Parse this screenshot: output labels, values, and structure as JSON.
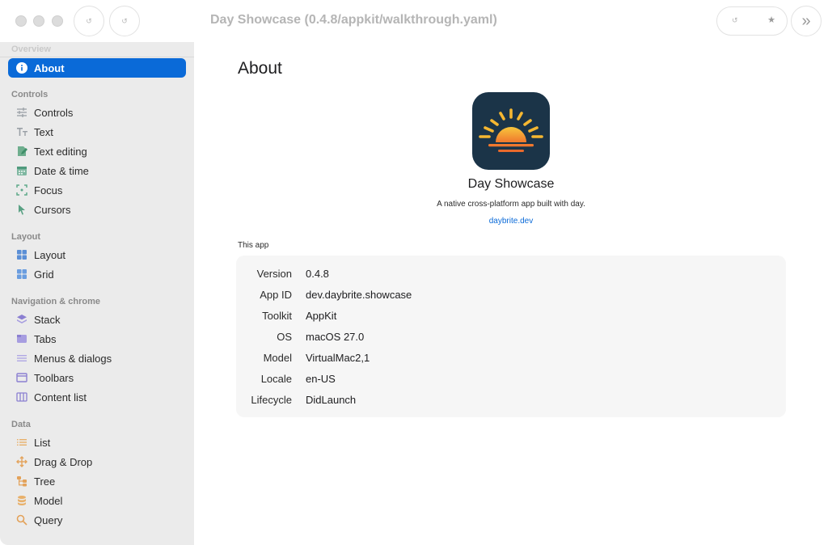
{
  "window": {
    "title": "Day Showcase (0.4.8/appkit/walkthrough.yaml)",
    "toolbar_left_button_1": "↺",
    "toolbar_left_button_2": "↺",
    "toolbar_pill_left": "↺",
    "toolbar_pill_right": "★",
    "forward_button": "»"
  },
  "sidebar": {
    "overview_label": "Overview",
    "sections": [
      {
        "label": "Controls"
      },
      {
        "label": "Layout"
      },
      {
        "label": "Navigation & chrome"
      },
      {
        "label": "Data"
      }
    ],
    "items": [
      {
        "label": "About",
        "icon": "info-icon",
        "active": true
      },
      {
        "label": "Controls",
        "icon": "sliders-icon"
      },
      {
        "label": "Text",
        "icon": "text-icon"
      },
      {
        "label": "Text editing",
        "icon": "pencil-doc-icon"
      },
      {
        "label": "Date & time",
        "icon": "calendar-icon"
      },
      {
        "label": "Focus",
        "icon": "focus-icon"
      },
      {
        "label": "Cursors",
        "icon": "cursor-icon"
      },
      {
        "label": "Layout",
        "icon": "layout-grid-icon"
      },
      {
        "label": "Grid",
        "icon": "grid-icon"
      },
      {
        "label": "Stack",
        "icon": "stack-icon"
      },
      {
        "label": "Tabs",
        "icon": "tabs-icon"
      },
      {
        "label": "Menus & dialogs",
        "icon": "menu-icon"
      },
      {
        "label": "Toolbars",
        "icon": "toolbar-icon"
      },
      {
        "label": "Content list",
        "icon": "columns-icon"
      },
      {
        "label": "List",
        "icon": "list-icon"
      },
      {
        "label": "Drag & Drop",
        "icon": "move-icon"
      },
      {
        "label": "Tree",
        "icon": "tree-icon"
      },
      {
        "label": "Model",
        "icon": "database-icon"
      },
      {
        "label": "Query",
        "icon": "magnifier-icon"
      }
    ]
  },
  "main": {
    "title": "About",
    "app_name": "Day Showcase",
    "tagline": "A native cross-platform app built with day.",
    "link": "daybrite.dev",
    "section_label": "This app",
    "info": [
      {
        "key": "Version",
        "value": "0.4.8"
      },
      {
        "key": "App ID",
        "value": "dev.daybrite.showcase"
      },
      {
        "key": "Toolkit",
        "value": "AppKit"
      },
      {
        "key": "OS",
        "value": "macOS 27.0"
      },
      {
        "key": "Model",
        "value": "VirtualMac2,1"
      },
      {
        "key": "Locale",
        "value": "en-US"
      },
      {
        "key": "Lifecycle",
        "value": "DidLaunch"
      }
    ]
  },
  "colors": {
    "accent": "#0a6ad8",
    "sidebar_bg": "#ebebeb",
    "icon_bg": "#1b3448",
    "sun": "#f5b731"
  }
}
